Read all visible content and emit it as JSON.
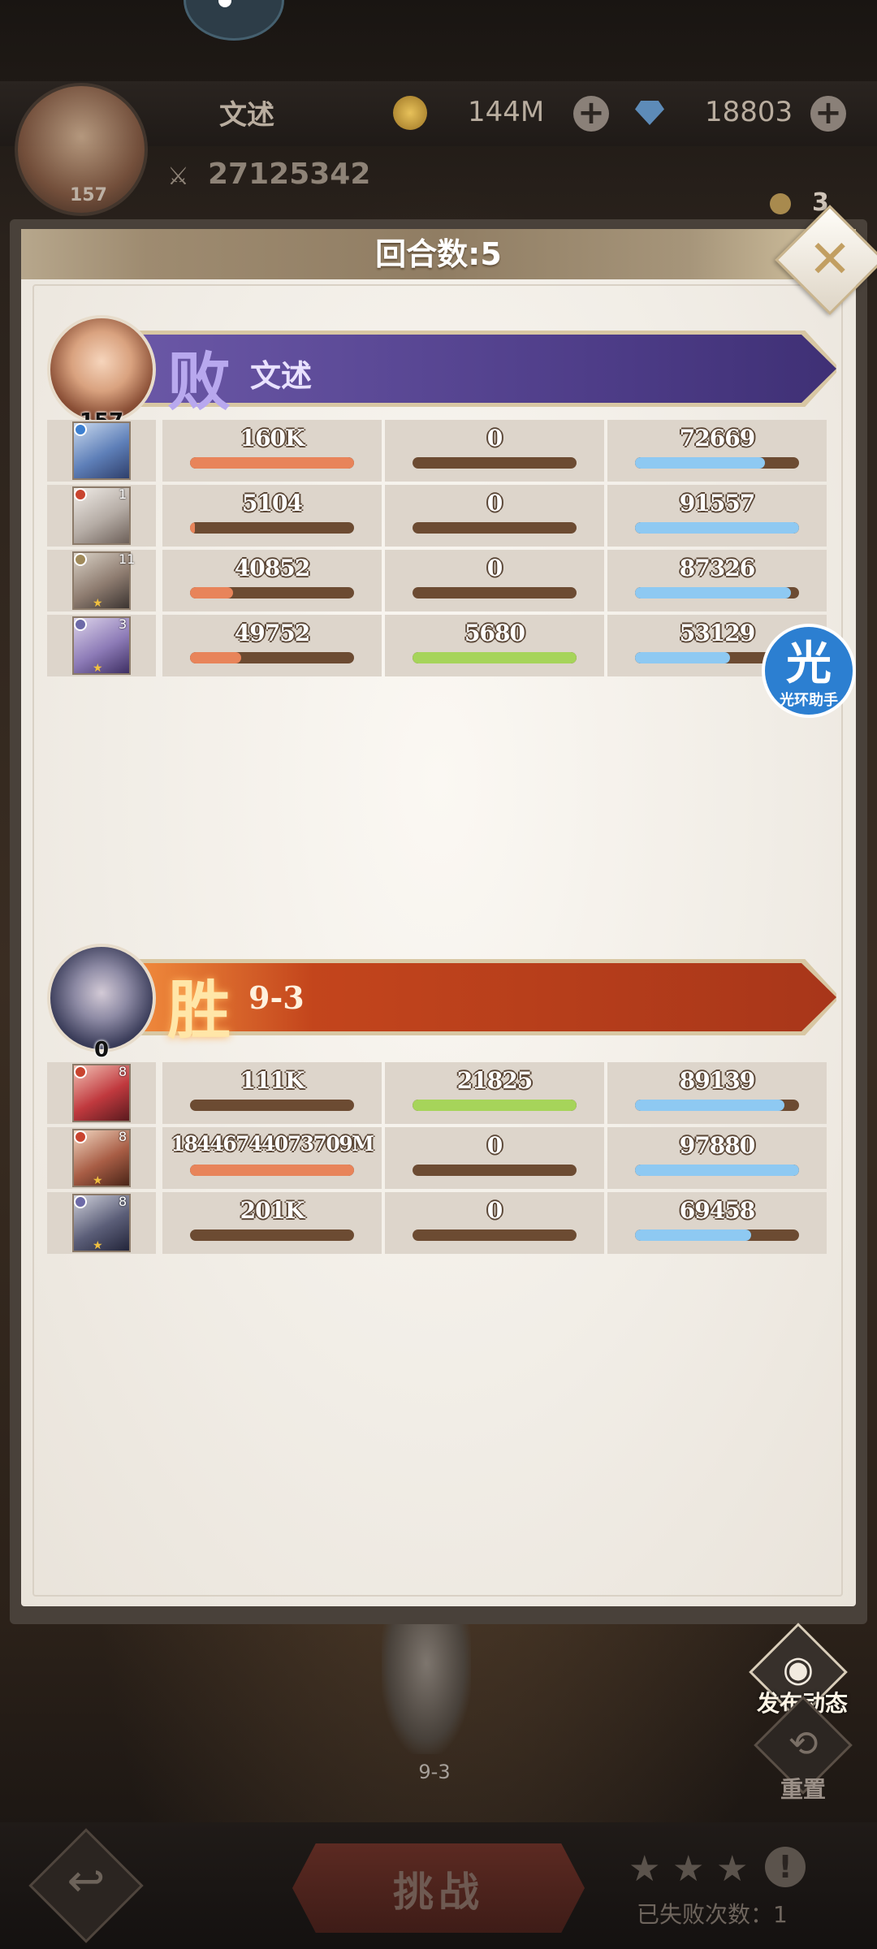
{
  "topbar": {
    "player_name": "文述",
    "player_level": "157",
    "gold": "144M",
    "gems": "18803",
    "power": "27125342",
    "keys": "3"
  },
  "modal": {
    "title": "回合数:5"
  },
  "lose_team": {
    "result": "败",
    "name": "文述",
    "leader_level": "157",
    "heroes": [
      {
        "level": "",
        "damage": "160K",
        "damage_fill": 1.0,
        "heal": "0",
        "heal_fill": 0.0,
        "hp": "72669",
        "hp_fill": 0.79
      },
      {
        "level": "1",
        "damage": "5104",
        "damage_fill": 0.03,
        "heal": "0",
        "heal_fill": 0.0,
        "hp": "91557",
        "hp_fill": 1.0
      },
      {
        "level": "11",
        "damage": "40852",
        "damage_fill": 0.26,
        "heal": "0",
        "heal_fill": 0.0,
        "hp": "87326",
        "hp_fill": 0.95
      },
      {
        "level": "3",
        "damage": "49752",
        "damage_fill": 0.31,
        "heal": "5680",
        "heal_fill": 1.0,
        "hp": "53129",
        "hp_fill": 0.58
      }
    ]
  },
  "win_team": {
    "result": "胜",
    "name": "9-3",
    "leader_level": "0",
    "heroes": [
      {
        "level": "8",
        "damage": "111K",
        "damage_fill": 0.0,
        "heal": "21825",
        "heal_fill": 1.0,
        "hp": "89139",
        "hp_fill": 0.91
      },
      {
        "level": "8",
        "damage": "18446744073709M",
        "damage_fill": 1.0,
        "heal": "0",
        "heal_fill": 0.0,
        "hp": "97880",
        "hp_fill": 1.0
      },
      {
        "level": "8",
        "damage": "201K",
        "damage_fill": 0.0,
        "heal": "0",
        "heal_fill": 0.0,
        "hp": "69458",
        "hp_fill": 0.71
      }
    ]
  },
  "helper": {
    "icon_char": "光",
    "label": "光环助手"
  },
  "scene": {
    "stage_label": "9-3",
    "publish_label": "发布动态",
    "reset_label": "重置"
  },
  "bottom": {
    "challenge_label": "挑战",
    "fail_count": "已失败次数：1",
    "stars": 0
  },
  "colors": {
    "damage": "#e8845a",
    "heal": "#a6d45a",
    "hp": "#8ec9f2",
    "lose_banner": "#4c3b86",
    "win_banner": "#c3451c"
  },
  "icons": [
    "back-arrow-icon",
    "camera-icon",
    "refresh-icon",
    "close-icon",
    "coin-icon",
    "gem-icon",
    "sword-icon",
    "star-icon",
    "warning-icon"
  ]
}
